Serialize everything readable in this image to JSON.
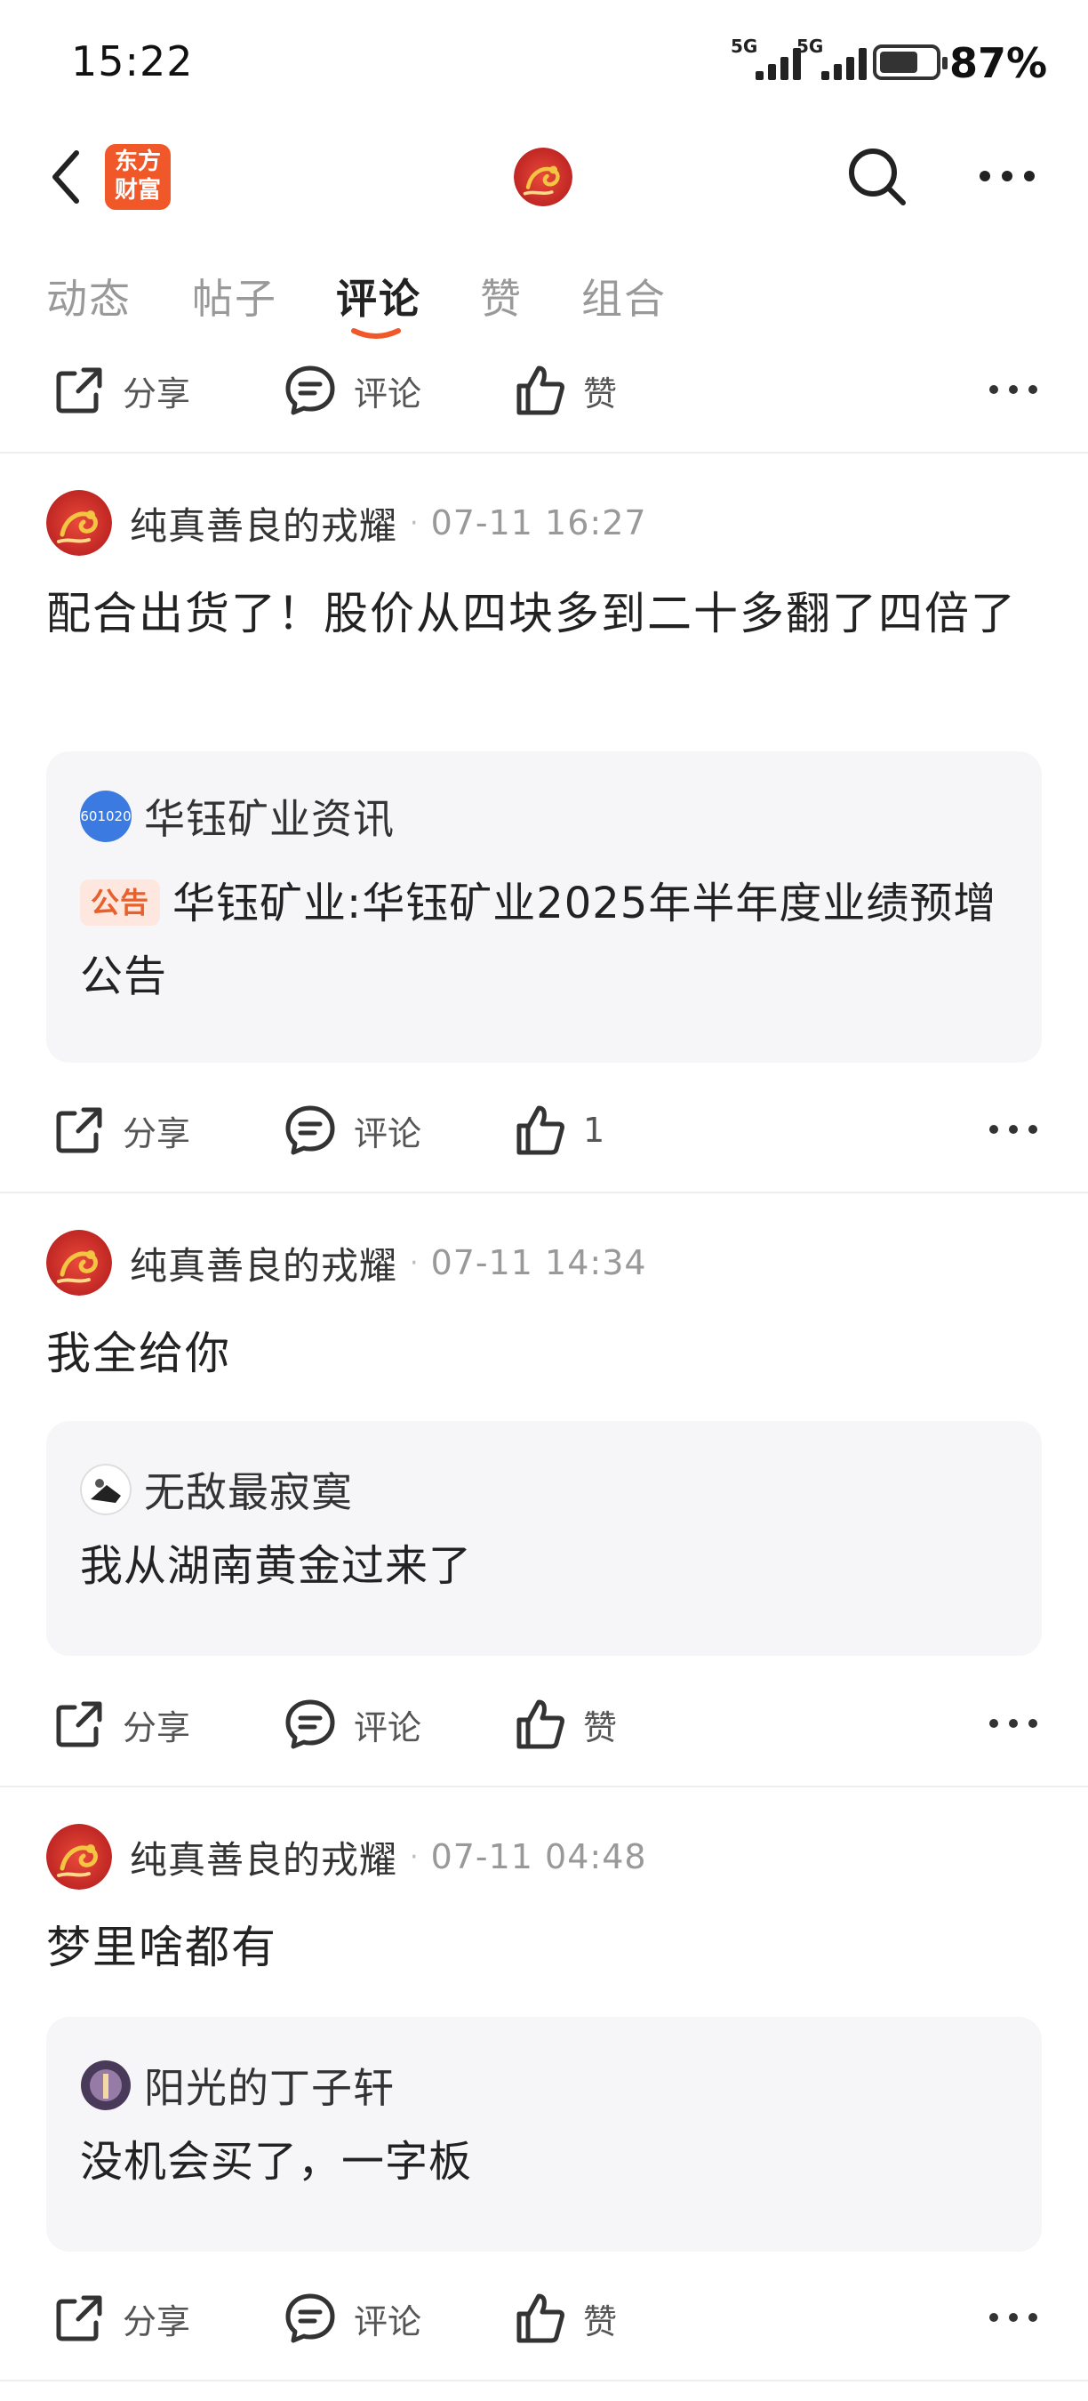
{
  "status_bar": {
    "time": "15:22",
    "signal1_label": "5G",
    "signal2_label": "5G",
    "battery": "87%",
    "battery_level": 0.87
  },
  "header": {
    "logo_text_line1": "东方",
    "logo_text_line2": "财富",
    "icons": [
      "back-arrow-icon",
      "search-icon",
      "more-icon"
    ]
  },
  "tabs": [
    {
      "label": "动态"
    },
    {
      "label": "帖子"
    },
    {
      "label": "评论",
      "active": true
    },
    {
      "label": "赞"
    },
    {
      "label": "组合"
    }
  ],
  "action_bars": [
    {
      "share": "分享",
      "comment": "评论",
      "like": "赞"
    },
    {
      "share": "分享",
      "comment": "评论",
      "like": "1"
    },
    {
      "share": "分享",
      "comment": "评论",
      "like": "赞"
    },
    {
      "share": "分享",
      "comment": "评论",
      "like": "赞"
    }
  ],
  "posts": [
    {
      "user": "纯真善良的戎耀",
      "time": "07-11 16:27",
      "text": "配合出货了！股价从四块多到二十多翻了四倍了",
      "quote": {
        "avatar_label": "601020",
        "name": "华钰矿业资讯",
        "badge": "公告",
        "text": "华钰矿业:华钰矿业2025年半年度业绩预增公告"
      }
    },
    {
      "user": "纯真善良的戎耀",
      "time": "07-11 14:34",
      "text": "我全给你",
      "quote": {
        "name": "无敌最寂寞",
        "text": "我从湖南黄金过来了"
      }
    },
    {
      "user": "纯真善良的戎耀",
      "time": "07-11 04:48",
      "text": "梦里啥都有",
      "quote": {
        "name": "阳光的丁子轩",
        "text": "没机会买了，一字板"
      }
    }
  ],
  "colors": {
    "brand": "#f0582a",
    "quote_bg": "#f6f6f8",
    "badge_bg": "#fde7de",
    "badge_text": "#e8612c"
  }
}
